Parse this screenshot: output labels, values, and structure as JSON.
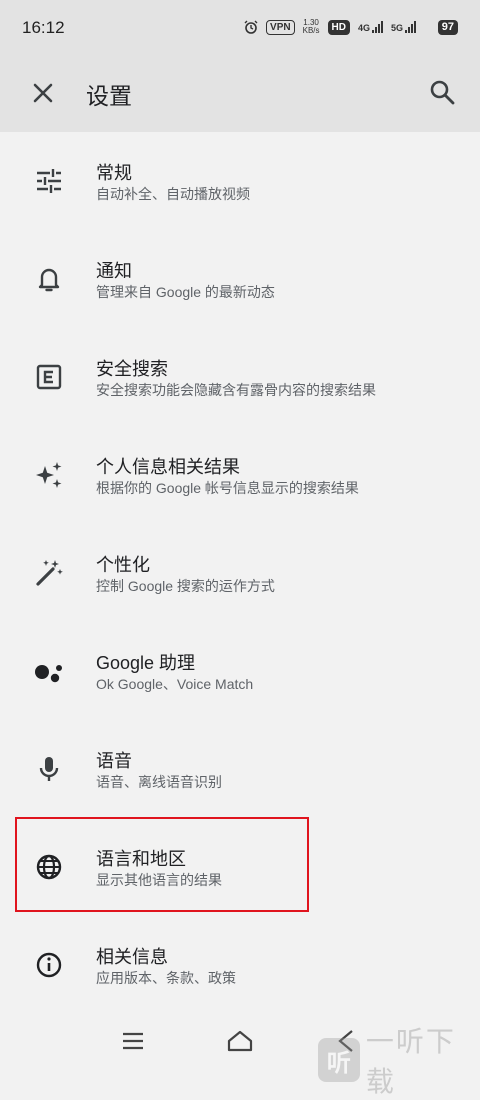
{
  "status_bar": {
    "time": "16:12",
    "vpn": "VPN",
    "net_speed_value": "1.30",
    "net_speed_unit": "KB/s",
    "hd": "HD",
    "sim1": "4G",
    "sim2": "5G",
    "battery": "97"
  },
  "app_bar": {
    "title": "设置"
  },
  "settings": [
    {
      "title": "常规",
      "subtitle": "自动补全、自动播放视频",
      "icon": "tune-icon"
    },
    {
      "title": "通知",
      "subtitle": "管理来自 Google 的最新动态",
      "icon": "bell-icon"
    },
    {
      "title": "安全搜索",
      "subtitle": "安全搜索功能会隐藏含有露骨内容的搜索结果",
      "icon": "explicit-icon"
    },
    {
      "title": "个人信息相关结果",
      "subtitle": "根据你的 Google 帐号信息显示的搜索结果",
      "icon": "sparkle-icon"
    },
    {
      "title": "个性化",
      "subtitle": "控制 Google 搜索的运作方式",
      "icon": "magic-wand-icon"
    },
    {
      "title": "Google 助理",
      "subtitle": "Ok Google、Voice Match",
      "icon": "assistant-icon"
    },
    {
      "title": "语音",
      "subtitle": "语音、离线语音识别",
      "icon": "mic-icon"
    },
    {
      "title": "语言和地区",
      "subtitle": "显示其他语言的结果",
      "icon": "globe-icon"
    },
    {
      "title": "相关信息",
      "subtitle": "应用版本、条款、政策",
      "icon": "info-icon"
    }
  ],
  "highlight_color": "#e0141e",
  "watermark": {
    "logo": "听",
    "text": "一听下载"
  }
}
